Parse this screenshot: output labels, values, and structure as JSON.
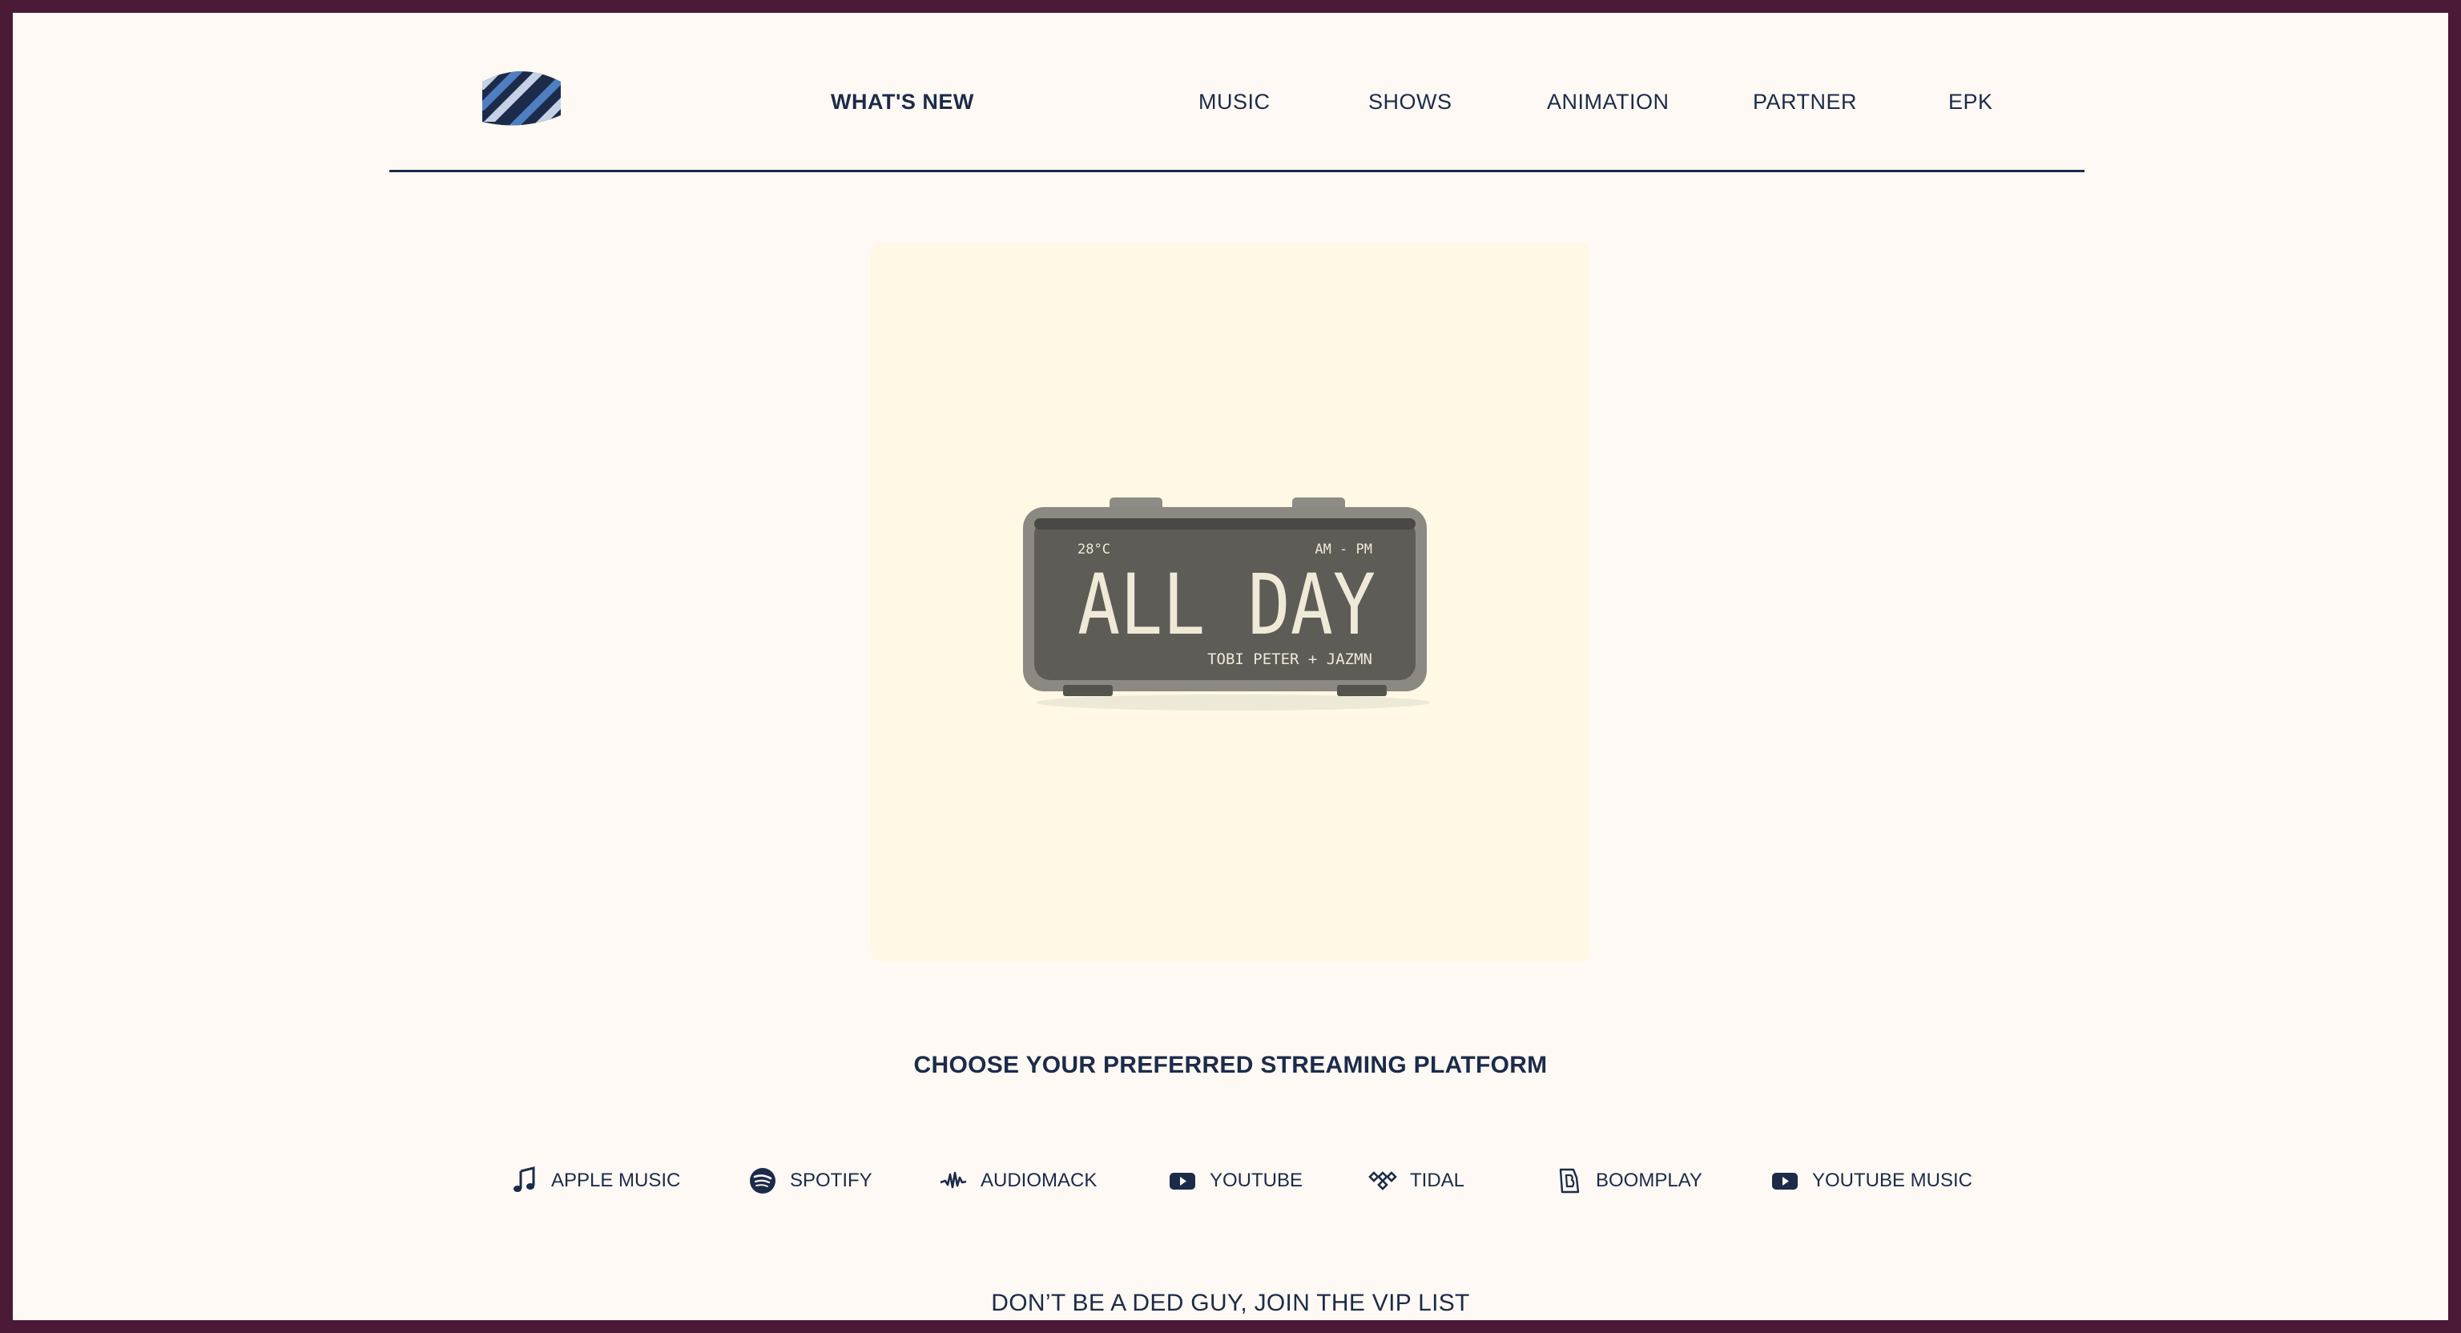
{
  "nav": {
    "logo": "logo",
    "items": [
      {
        "label": "WHAT'S NEW",
        "active": true
      },
      {
        "label": "MUSIC"
      },
      {
        "label": "SHOWS"
      },
      {
        "label": "ANIMATION"
      },
      {
        "label": "PARTNER"
      },
      {
        "label": "EPK"
      }
    ]
  },
  "cover": {
    "title": "ALL DAY",
    "artists": "TOBI PETER + JAZMN",
    "temperature": "28°C",
    "ampm": "AM - PM"
  },
  "streaming": {
    "heading": "CHOOSE YOUR PREFERRED STREAMING PLATFORM",
    "platforms": [
      {
        "label": "APPLE MUSIC",
        "icon": "music-note-icon"
      },
      {
        "label": "SPOTIFY",
        "icon": "spotify-icon"
      },
      {
        "label": "AUDIOMACK",
        "icon": "audiomack-icon"
      },
      {
        "label": "YOUTUBE",
        "icon": "youtube-icon"
      },
      {
        "label": "TIDAL",
        "icon": "tidal-icon"
      },
      {
        "label": "BOOMPLAY",
        "icon": "boomplay-icon"
      },
      {
        "label": "YOUTUBE MUSIC",
        "icon": "youtube-icon"
      }
    ]
  },
  "vip": {
    "text": "DON’T BE A DED GUY, JOIN THE VIP LIST"
  },
  "colors": {
    "frame": "#4a1a36",
    "background": "#fef9f4",
    "text": "#1c2b4a",
    "cover": "#fef8e4"
  }
}
